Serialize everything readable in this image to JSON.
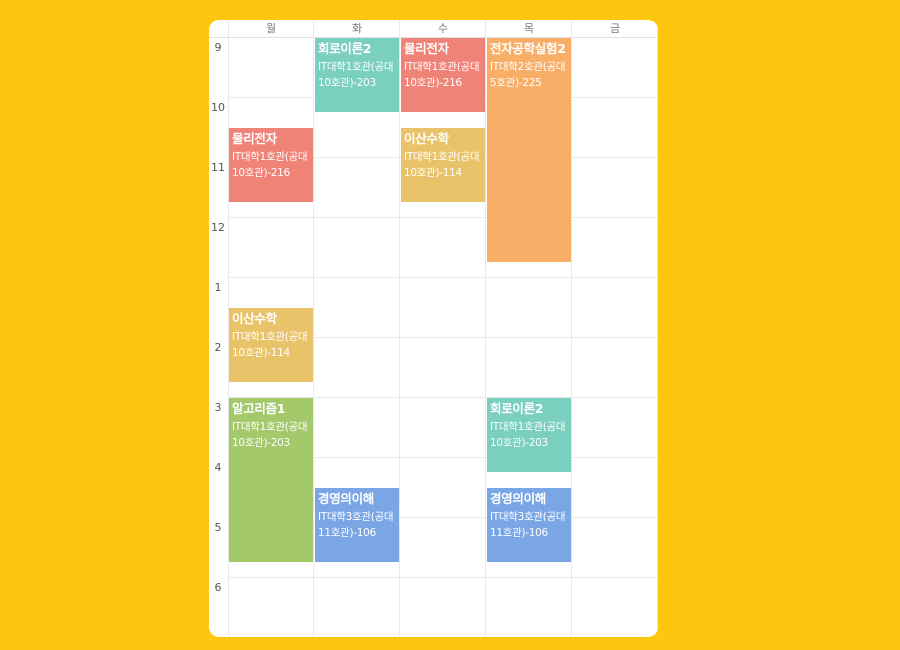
{
  "days": [
    "월",
    "화",
    "수",
    "목",
    "금"
  ],
  "hours": [
    "9",
    "10",
    "11",
    "12",
    "1",
    "2",
    "3",
    "4",
    "5",
    "6"
  ],
  "events": [
    {
      "title": "물리전자",
      "room": "IT대학1호관(공대10호관)-216",
      "color": "#F08377",
      "day": 0,
      "start": 10.5,
      "end": 11.75
    },
    {
      "title": "이산수학",
      "room": "IT대학1호관(공대10호관)-114",
      "color": "#E9C36A",
      "day": 0,
      "start": 13.5,
      "end": 14.75
    },
    {
      "title": "알고리즘1",
      "room": "IT대학1호관(공대10호관)-203",
      "color": "#A3C96B",
      "day": 0,
      "start": 15.0,
      "end": 17.75
    },
    {
      "title": "회로이론2",
      "room": "IT대학1호관(공대10호관)-203",
      "color": "#7ACFBF",
      "day": 1,
      "start": 9.0,
      "end": 10.25
    },
    {
      "title": "경영의이해",
      "room": "IT대학3호관(공대11호관)-106",
      "color": "#7AA6E6",
      "day": 1,
      "start": 16.5,
      "end": 17.75
    },
    {
      "title": "물리전자",
      "room": "IT대학1호관(공대10호관)-216",
      "color": "#F08377",
      "day": 2,
      "start": 9.0,
      "end": 10.25
    },
    {
      "title": "이산수학",
      "room": "IT대학1호관(공대10호관)-114",
      "color": "#E9C36A",
      "day": 2,
      "start": 10.5,
      "end": 11.75
    },
    {
      "title": "전자공학실험2",
      "room": "IT대학2호관(공대5호관)-225",
      "color": "#F9AE68",
      "day": 3,
      "start": 9.0,
      "end": 12.75
    },
    {
      "title": "회로이론2",
      "room": "IT대학1호관(공대10호관)-203",
      "color": "#7ACFBF",
      "day": 3,
      "start": 15.0,
      "end": 16.25
    },
    {
      "title": "경영의이해",
      "room": "IT대학3호관(공대11호관)-106",
      "color": "#7AA6E6",
      "day": 3,
      "start": 16.5,
      "end": 17.75
    }
  ]
}
